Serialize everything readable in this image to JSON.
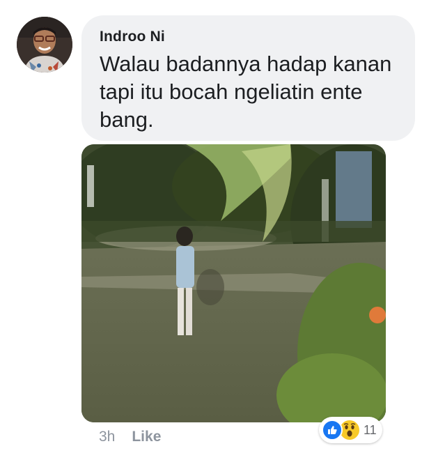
{
  "comment": {
    "author": "Indroo Ni",
    "text": "Walau badannya hadap kanan tapi itu bocah ngeliatin ente bang.",
    "time": "3h",
    "like_label": "Like"
  },
  "reactions": {
    "icons": [
      "like-icon",
      "wow-icon"
    ],
    "count": "11",
    "colors": {
      "like": "#1877f2",
      "wow": "#f7c928"
    }
  },
  "avatar": {
    "icon": "profile-photo"
  },
  "attachment": {
    "icon": "photo-attachment"
  }
}
